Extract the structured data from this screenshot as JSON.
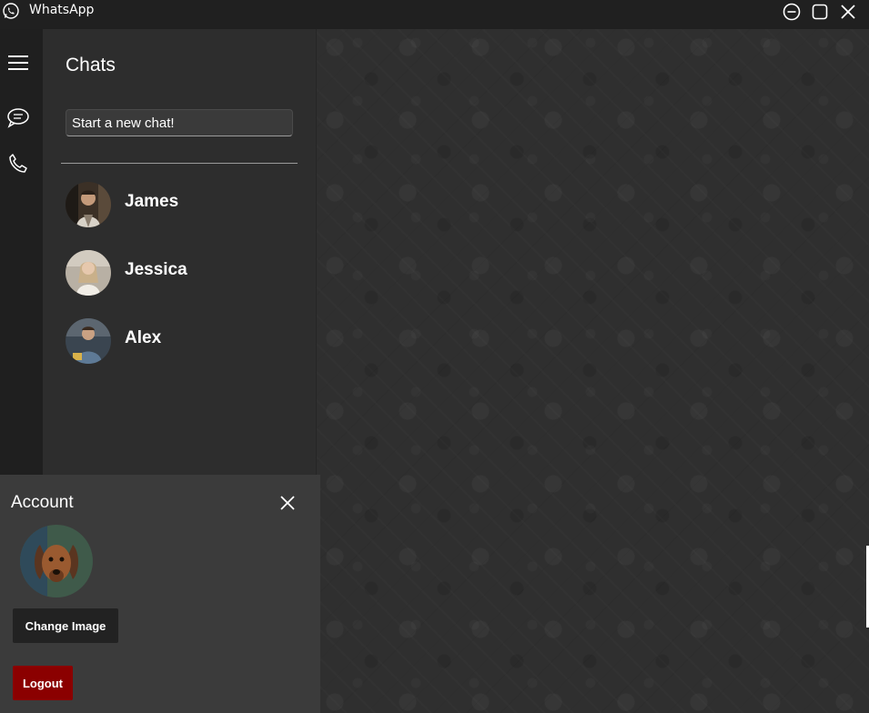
{
  "titlebar": {
    "app_title": "WhatsApp",
    "icons": [
      "whatsapp-logo-icon",
      "minimize-icon",
      "maximize-icon",
      "close-icon"
    ]
  },
  "rail": {
    "items": [
      {
        "icon": "hamburger-menu-icon"
      },
      {
        "icon": "chat-bubble-icon"
      },
      {
        "icon": "phone-icon"
      }
    ]
  },
  "chats": {
    "heading": "Chats",
    "new_chat_value": "Start a new chat!",
    "contacts": [
      {
        "name": "James",
        "avatar": "avatar-photo-icon"
      },
      {
        "name": "Jessica",
        "avatar": "avatar-photo-icon"
      },
      {
        "name": "Alex",
        "avatar": "avatar-photo-icon"
      }
    ]
  },
  "account": {
    "title": "Account",
    "avatar": "dog-photo-icon",
    "change_image_label": "Change Image",
    "logout_label": "Logout"
  },
  "colors": {
    "titlebar": "#202020",
    "rail": "#1f1f1f",
    "chat_pane": "#2d2d2d",
    "chat_area": "#2f2f2f",
    "account_panel": "#3b3b3b",
    "change_image_button": "#222222",
    "logout_button": "#8b0000"
  }
}
